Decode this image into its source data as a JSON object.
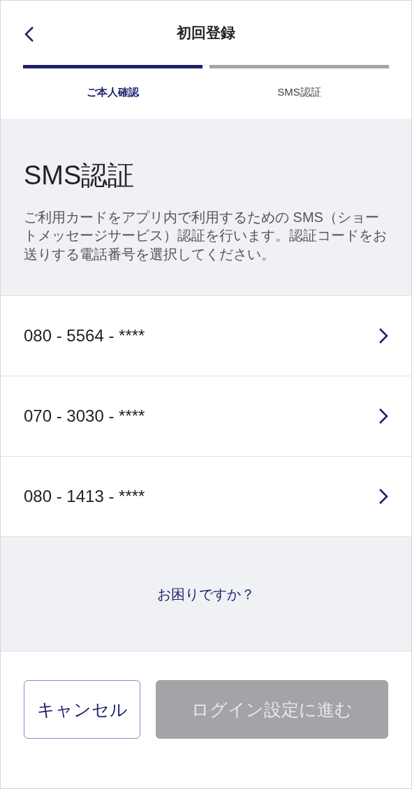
{
  "header": {
    "title": "初回登録"
  },
  "steps": [
    {
      "label": "ご本人確認",
      "selected": true
    },
    {
      "label": "SMS認証",
      "selected": false
    }
  ],
  "intro": {
    "heading": "SMS認証",
    "description": "ご利用カードをアプリ内で利用するための SMS（ショートメッセージサービス）認証を行います。認証コードをお送りする電話番号を選択してください。"
  },
  "phones": [
    {
      "number": "080 - 5564 - ****"
    },
    {
      "number": "070 - 3030 - ****"
    },
    {
      "number": "080 - 1413 - ****"
    }
  ],
  "help_link": "お困りですか？",
  "buttons": [
    {
      "label": "キャンセル",
      "kind": "secondary",
      "disabled": false
    },
    {
      "label": "ログイン設定に進む",
      "kind": "primary",
      "disabled": true
    }
  ]
}
